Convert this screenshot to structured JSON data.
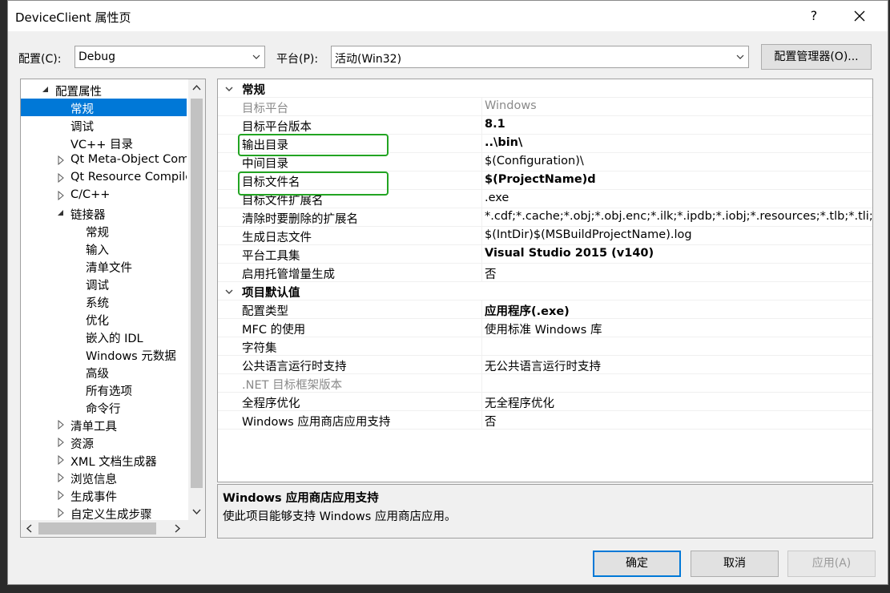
{
  "window": {
    "title": "DeviceClient 属性页",
    "help": "?"
  },
  "config": {
    "config_label": "配置(C):",
    "config_value": "Debug",
    "platform_label": "平台(P):",
    "platform_value": "活动(Win32)",
    "manager_button": "配置管理器(O)..."
  },
  "tree": [
    {
      "text": "配置属性",
      "level": 0,
      "exp": "open"
    },
    {
      "text": "常规",
      "level": 1,
      "exp": "",
      "selected": true
    },
    {
      "text": "调试",
      "level": 1,
      "exp": ""
    },
    {
      "text": "VC++ 目录",
      "level": 1,
      "exp": ""
    },
    {
      "text": "Qt Meta-Object Compiler",
      "level": 1,
      "exp": "closed"
    },
    {
      "text": "Qt Resource Compiler",
      "level": 1,
      "exp": "closed"
    },
    {
      "text": "C/C++",
      "level": 1,
      "exp": "closed"
    },
    {
      "text": "链接器",
      "level": 1,
      "exp": "open"
    },
    {
      "text": "常规",
      "level": 2,
      "exp": ""
    },
    {
      "text": "输入",
      "level": 2,
      "exp": ""
    },
    {
      "text": "清单文件",
      "level": 2,
      "exp": ""
    },
    {
      "text": "调试",
      "level": 2,
      "exp": ""
    },
    {
      "text": "系统",
      "level": 2,
      "exp": ""
    },
    {
      "text": "优化",
      "level": 2,
      "exp": ""
    },
    {
      "text": "嵌入的 IDL",
      "level": 2,
      "exp": ""
    },
    {
      "text": "Windows 元数据",
      "level": 2,
      "exp": ""
    },
    {
      "text": "高级",
      "level": 2,
      "exp": ""
    },
    {
      "text": "所有选项",
      "level": 2,
      "exp": ""
    },
    {
      "text": "命令行",
      "level": 2,
      "exp": ""
    },
    {
      "text": "清单工具",
      "level": 1,
      "exp": "closed"
    },
    {
      "text": "资源",
      "level": 1,
      "exp": "closed"
    },
    {
      "text": "XML 文档生成器",
      "level": 1,
      "exp": "closed"
    },
    {
      "text": "浏览信息",
      "level": 1,
      "exp": "closed"
    },
    {
      "text": "生成事件",
      "level": 1,
      "exp": "closed"
    },
    {
      "text": "自定义生成步骤",
      "level": 1,
      "exp": "closed"
    }
  ],
  "properties": [
    {
      "category": "常规"
    },
    {
      "name": "目标平台",
      "value": "Windows",
      "dim": true
    },
    {
      "name": "目标平台版本",
      "value": "8.1",
      "bold": true
    },
    {
      "name": "输出目录",
      "value": "..\\bin\\",
      "bold": true
    },
    {
      "name": "中间目录",
      "value": "$(Configuration)\\"
    },
    {
      "name": "目标文件名",
      "value": "$(ProjectName)d",
      "bold": true
    },
    {
      "name": "目标文件扩展名",
      "value": ".exe"
    },
    {
      "name": "清除时要删除的扩展名",
      "value": "*.cdf;*.cache;*.obj;*.obj.enc;*.ilk;*.ipdb;*.iobj;*.resources;*.tlb;*.tli;*"
    },
    {
      "name": "生成日志文件",
      "value": "$(IntDir)$(MSBuildProjectName).log"
    },
    {
      "name": "平台工具集",
      "value": "Visual Studio 2015 (v140)",
      "bold": true
    },
    {
      "name": "启用托管增量生成",
      "value": "否"
    },
    {
      "category": "项目默认值"
    },
    {
      "name": "配置类型",
      "value": "应用程序(.exe)",
      "bold": true
    },
    {
      "name": "MFC 的使用",
      "value": "使用标准 Windows 库"
    },
    {
      "name": "字符集",
      "value": ""
    },
    {
      "name": "公共语言运行时支持",
      "value": "无公共语言运行时支持"
    },
    {
      "name": ".NET 目标框架版本",
      "value": "",
      "dim": true
    },
    {
      "name": "全程序优化",
      "value": "无全程序优化"
    },
    {
      "name": "Windows 应用商店应用支持",
      "value": "否"
    }
  ],
  "description": {
    "title": "Windows 应用商店应用支持",
    "text": "使此项目能够支持 Windows 应用商店应用。"
  },
  "buttons": {
    "ok": "确定",
    "cancel": "取消",
    "apply": "应用(A)"
  },
  "colors": {
    "selection": "#0078d7",
    "highlight_box": "#22a422"
  }
}
